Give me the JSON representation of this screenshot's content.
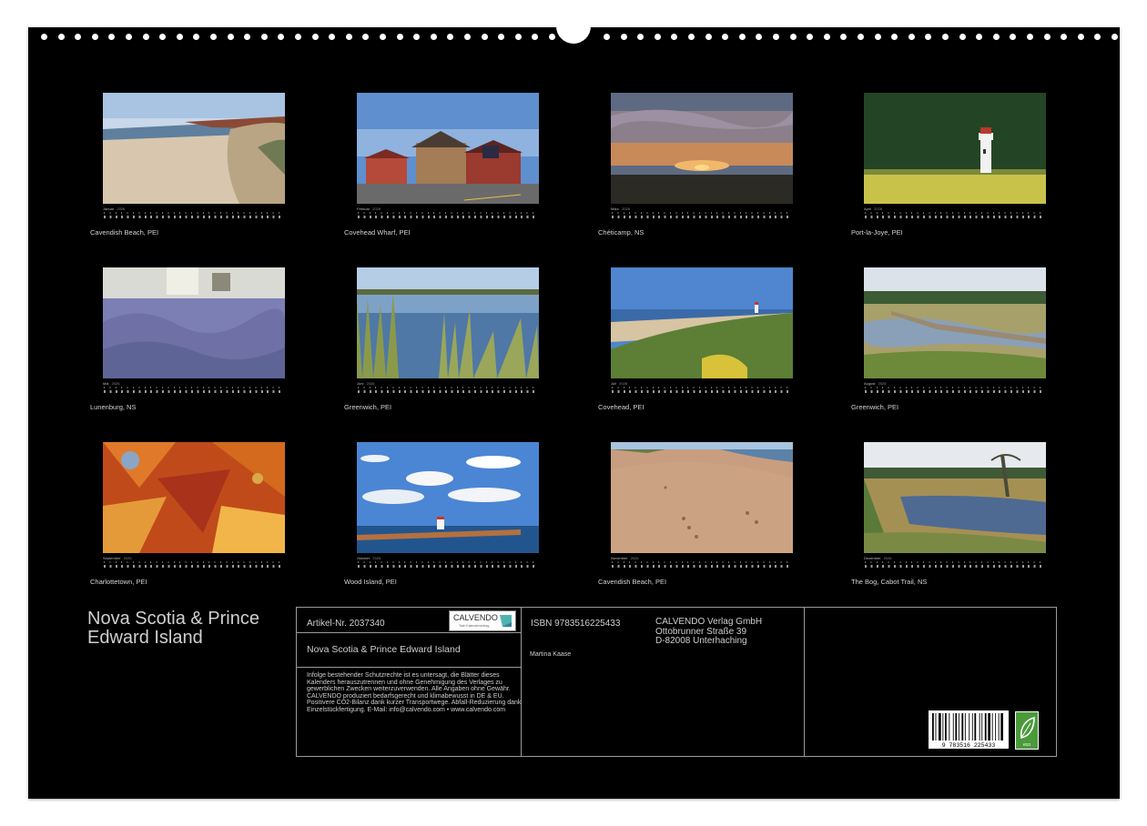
{
  "months": [
    {
      "month": "Januar",
      "year": "2026",
      "caption": "Cavendish Beach, PEI",
      "scene": "beach-dunes"
    },
    {
      "month": "Februar",
      "year": "2026",
      "caption": "Covehead Wharf, PEI",
      "scene": "wharf-buildings"
    },
    {
      "month": "März",
      "year": "2026",
      "caption": "Chéticamp, NS",
      "scene": "sunset"
    },
    {
      "month": "April",
      "year": "2026",
      "caption": "Port-la-Joye, PEI",
      "scene": "lighthouse-forest"
    },
    {
      "month": "Mai",
      "year": "2026",
      "caption": "Lunenburg, NS",
      "scene": "lavender"
    },
    {
      "month": "Juni",
      "year": "2026",
      "caption": "Greenwich, PEI",
      "scene": "pond-reeds"
    },
    {
      "month": "Juli",
      "year": "2026",
      "caption": "Covehead, PEI",
      "scene": "coast-dunes"
    },
    {
      "month": "August",
      "year": "2026",
      "caption": "Greenwich, PEI",
      "scene": "boardwalk"
    },
    {
      "month": "September",
      "year": "2026",
      "caption": "Charlottetown, PEI",
      "scene": "maple-leaves"
    },
    {
      "month": "Oktober",
      "year": "2026",
      "caption": "Wood Island, PEI",
      "scene": "clouds-lighthouse"
    },
    {
      "month": "November",
      "year": "2026",
      "caption": "Cavendish Beach, PEI",
      "scene": "sand-footprints"
    },
    {
      "month": "Dezember",
      "year": "2026",
      "caption": "The Bog, Cabot Trail, NS",
      "scene": "bog"
    }
  ],
  "title": "Nova Scotia & Prince Edward Island",
  "info": {
    "article": "Artikel-Nr. 2037340",
    "logo_text": "CALVENDO",
    "logo_sub": "Tash Kalendervertrag",
    "subtitle": "Nova Scotia & Prince Edward Island",
    "legal": "Infolge bestehender Schutzrechte ist es untersagt, die Blätter dieses Kalenders herauszutrennen und ohne Genehmigung des Verlages zu gewerblichen Zwecken weiterzuverwenden. Alle Angaben ohne Gewähr. CALVENDO produziert bedarfsgerecht und klimabewusst in DE & EU. Positivere CO2-Bilanz dank kurzer Transportwege. Abfall-Reduzierung dank Einzelstückfertigung. E-Mail: info@calvendo.com • www.calvendo.com",
    "isbn": "ISBN 9783516225433",
    "author": "Martina Kaase",
    "publisher_name": "CALVENDO Verlag GmbH",
    "publisher_street": "Ottobrunner Straße 39",
    "publisher_city": "D-82008 Unterhaching",
    "barcode_digits": "9 783516 225433",
    "eco_label": "eco"
  }
}
